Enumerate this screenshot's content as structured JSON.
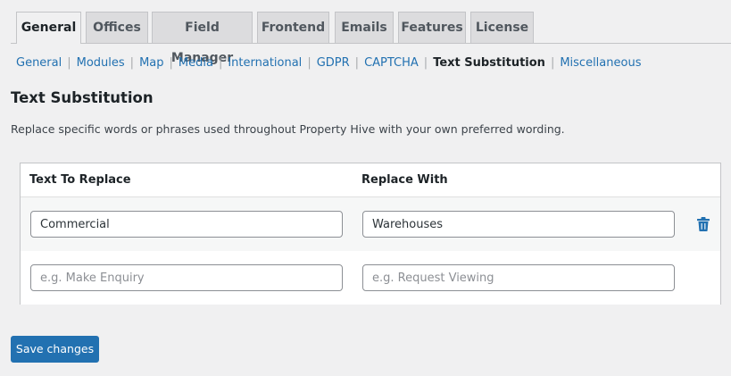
{
  "tabs": [
    {
      "label": "General",
      "active": true
    },
    {
      "label": "Offices"
    },
    {
      "label": "Field Manager"
    },
    {
      "label": "Frontend"
    },
    {
      "label": "Emails"
    },
    {
      "label": "Features"
    },
    {
      "label": "License"
    }
  ],
  "subnav": {
    "items": [
      "General",
      "Modules",
      "Map",
      "Media",
      "International",
      "GDPR",
      "CAPTCHA",
      "Text Substitution",
      "Miscellaneous"
    ],
    "separator": "|",
    "current": "Text Substitution"
  },
  "section": {
    "title": "Text Substitution",
    "description": "Replace specific words or phrases used throughout Property Hive with your own preferred wording."
  },
  "table": {
    "headers": [
      "Text To Replace",
      "Replace With"
    ],
    "rows": [
      {
        "replace": "Commercial",
        "with": "Warehouses",
        "delete_icon": "trash-icon"
      }
    ],
    "new_row": {
      "replace_placeholder": "e.g. Make Enquiry",
      "with_placeholder": "e.g. Request Viewing"
    }
  },
  "actions": {
    "save_label": "Save changes"
  },
  "colors": {
    "accent": "#2271b1",
    "background": "#f0f0f1",
    "tab_inactive": "#dcdcde"
  }
}
